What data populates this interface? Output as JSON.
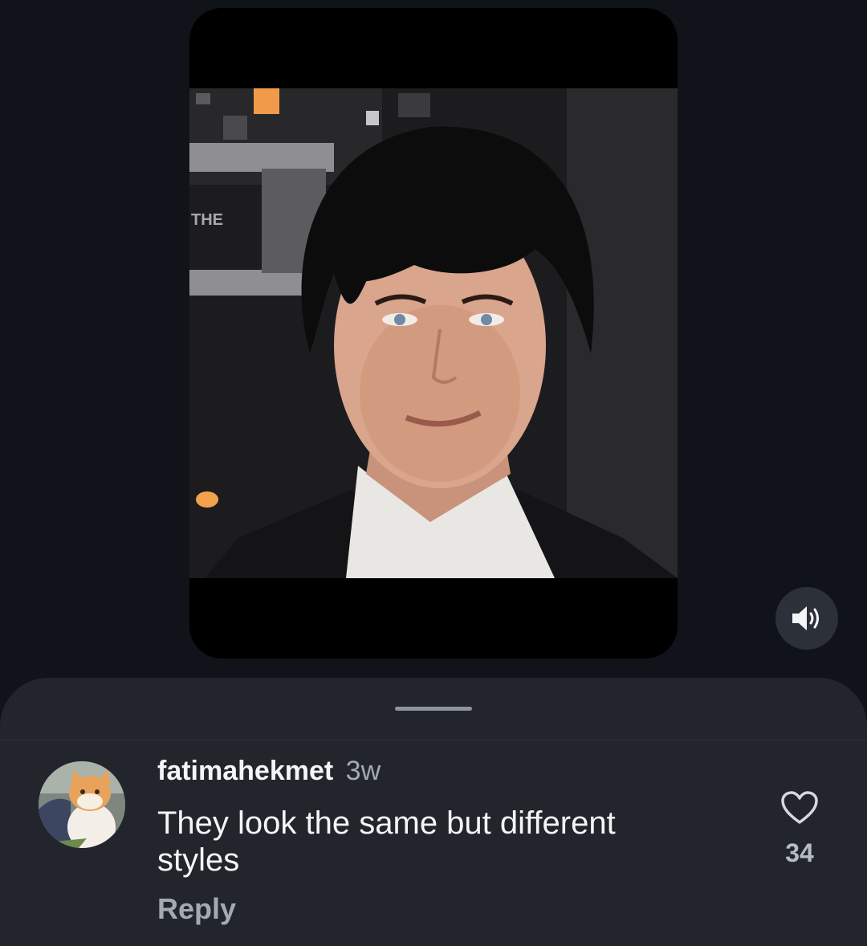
{
  "media": {
    "sign_text": "THE"
  },
  "controls": {
    "mute_icon": "speaker-volume-icon"
  },
  "comment": {
    "username": "fatimahekmet",
    "timestamp": "3w",
    "text": "They look the same but different styles",
    "reply_label": "Reply",
    "like_icon": "heart-outline-icon",
    "like_count": "34"
  },
  "colors": {
    "background": "#101319",
    "sheet": "#22252b",
    "secondary_text": "#a4aab3"
  }
}
